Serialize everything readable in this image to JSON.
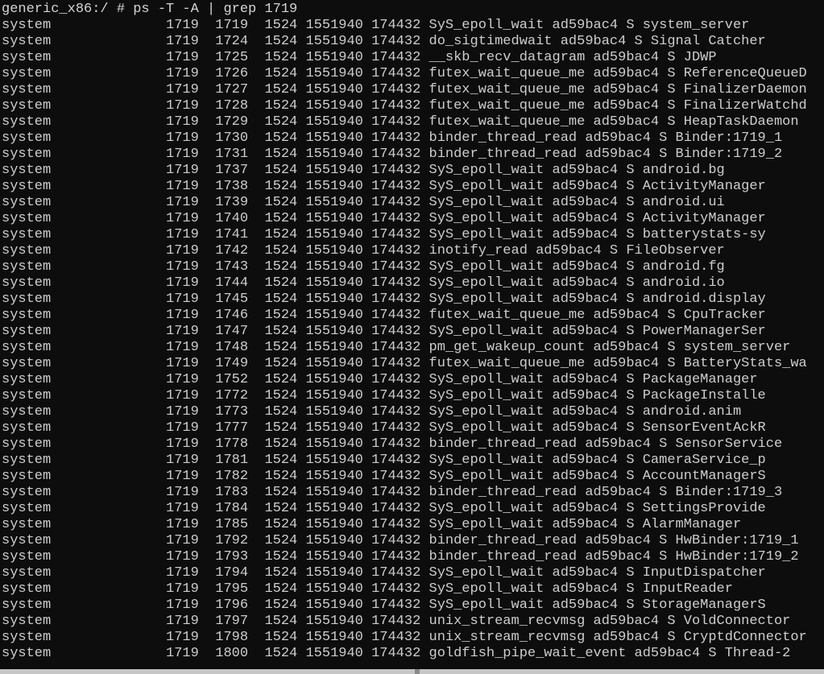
{
  "terminal": {
    "colors": {
      "background": "#0d0d0d",
      "foreground": "#cfcfcf",
      "scrollbar_track": "#c6c6c6",
      "scrollbar_thumb": "#8a8a8a"
    },
    "prompt": {
      "host": "generic_x86",
      "path": "/",
      "symbol": "#",
      "command": "ps -T -A | grep 1719",
      "full_line": "generic_x86:/ # ps -T -A | grep 1719"
    },
    "columns": {
      "user_width": 18,
      "pid_width": 6,
      "tid_width": 6,
      "ppid_width": 6,
      "vsz_width": 8,
      "rss_width": 7
    },
    "rows": [
      {
        "user": "system",
        "pid": "1719",
        "tid": "1719",
        "ppid": "1524",
        "vsz": "1551940",
        "rss": "174432",
        "wchan": "SyS_epoll_wait",
        "addr": "ad59bac4",
        "s": "S",
        "name": "system_server"
      },
      {
        "user": "system",
        "pid": "1719",
        "tid": "1724",
        "ppid": "1524",
        "vsz": "1551940",
        "rss": "174432",
        "wchan": "do_sigtimedwait",
        "addr": "ad59bac4",
        "s": "S",
        "name": "Signal Catcher"
      },
      {
        "user": "system",
        "pid": "1719",
        "tid": "1725",
        "ppid": "1524",
        "vsz": "1551940",
        "rss": "174432",
        "wchan": "__skb_recv_datagram",
        "addr": "ad59bac4",
        "s": "S",
        "name": "JDWP"
      },
      {
        "user": "system",
        "pid": "1719",
        "tid": "1726",
        "ppid": "1524",
        "vsz": "1551940",
        "rss": "174432",
        "wchan": "futex_wait_queue_me",
        "addr": "ad59bac4",
        "s": "S",
        "name": "ReferenceQueueD"
      },
      {
        "user": "system",
        "pid": "1719",
        "tid": "1727",
        "ppid": "1524",
        "vsz": "1551940",
        "rss": "174432",
        "wchan": "futex_wait_queue_me",
        "addr": "ad59bac4",
        "s": "S",
        "name": "FinalizerDaemon"
      },
      {
        "user": "system",
        "pid": "1719",
        "tid": "1728",
        "ppid": "1524",
        "vsz": "1551940",
        "rss": "174432",
        "wchan": "futex_wait_queue_me",
        "addr": "ad59bac4",
        "s": "S",
        "name": "FinalizerWatchd"
      },
      {
        "user": "system",
        "pid": "1719",
        "tid": "1729",
        "ppid": "1524",
        "vsz": "1551940",
        "rss": "174432",
        "wchan": "futex_wait_queue_me",
        "addr": "ad59bac4",
        "s": "S",
        "name": "HeapTaskDaemon"
      },
      {
        "user": "system",
        "pid": "1719",
        "tid": "1730",
        "ppid": "1524",
        "vsz": "1551940",
        "rss": "174432",
        "wchan": "binder_thread_read",
        "addr": "ad59bac4",
        "s": "S",
        "name": "Binder:1719_1"
      },
      {
        "user": "system",
        "pid": "1719",
        "tid": "1731",
        "ppid": "1524",
        "vsz": "1551940",
        "rss": "174432",
        "wchan": "binder_thread_read",
        "addr": "ad59bac4",
        "s": "S",
        "name": "Binder:1719_2"
      },
      {
        "user": "system",
        "pid": "1719",
        "tid": "1737",
        "ppid": "1524",
        "vsz": "1551940",
        "rss": "174432",
        "wchan": "SyS_epoll_wait",
        "addr": "ad59bac4",
        "s": "S",
        "name": "android.bg"
      },
      {
        "user": "system",
        "pid": "1719",
        "tid": "1738",
        "ppid": "1524",
        "vsz": "1551940",
        "rss": "174432",
        "wchan": "SyS_epoll_wait",
        "addr": "ad59bac4",
        "s": "S",
        "name": "ActivityManager"
      },
      {
        "user": "system",
        "pid": "1719",
        "tid": "1739",
        "ppid": "1524",
        "vsz": "1551940",
        "rss": "174432",
        "wchan": "SyS_epoll_wait",
        "addr": "ad59bac4",
        "s": "S",
        "name": "android.ui"
      },
      {
        "user": "system",
        "pid": "1719",
        "tid": "1740",
        "ppid": "1524",
        "vsz": "1551940",
        "rss": "174432",
        "wchan": "SyS_epoll_wait",
        "addr": "ad59bac4",
        "s": "S",
        "name": "ActivityManager"
      },
      {
        "user": "system",
        "pid": "1719",
        "tid": "1741",
        "ppid": "1524",
        "vsz": "1551940",
        "rss": "174432",
        "wchan": "SyS_epoll_wait",
        "addr": "ad59bac4",
        "s": "S",
        "name": "batterystats-sy"
      },
      {
        "user": "system",
        "pid": "1719",
        "tid": "1742",
        "ppid": "1524",
        "vsz": "1551940",
        "rss": "174432",
        "wchan": "inotify_read",
        "addr": "ad59bac4",
        "s": "S",
        "name": "FileObserver"
      },
      {
        "user": "system",
        "pid": "1719",
        "tid": "1743",
        "ppid": "1524",
        "vsz": "1551940",
        "rss": "174432",
        "wchan": "SyS_epoll_wait",
        "addr": "ad59bac4",
        "s": "S",
        "name": "android.fg"
      },
      {
        "user": "system",
        "pid": "1719",
        "tid": "1744",
        "ppid": "1524",
        "vsz": "1551940",
        "rss": "174432",
        "wchan": "SyS_epoll_wait",
        "addr": "ad59bac4",
        "s": "S",
        "name": "android.io"
      },
      {
        "user": "system",
        "pid": "1719",
        "tid": "1745",
        "ppid": "1524",
        "vsz": "1551940",
        "rss": "174432",
        "wchan": "SyS_epoll_wait",
        "addr": "ad59bac4",
        "s": "S",
        "name": "android.display"
      },
      {
        "user": "system",
        "pid": "1719",
        "tid": "1746",
        "ppid": "1524",
        "vsz": "1551940",
        "rss": "174432",
        "wchan": "futex_wait_queue_me",
        "addr": "ad59bac4",
        "s": "S",
        "name": "CpuTracker"
      },
      {
        "user": "system",
        "pid": "1719",
        "tid": "1747",
        "ppid": "1524",
        "vsz": "1551940",
        "rss": "174432",
        "wchan": "SyS_epoll_wait",
        "addr": "ad59bac4",
        "s": "S",
        "name": "PowerManagerSer"
      },
      {
        "user": "system",
        "pid": "1719",
        "tid": "1748",
        "ppid": "1524",
        "vsz": "1551940",
        "rss": "174432",
        "wchan": "pm_get_wakeup_count",
        "addr": "ad59bac4",
        "s": "S",
        "name": "system_server"
      },
      {
        "user": "system",
        "pid": "1719",
        "tid": "1749",
        "ppid": "1524",
        "vsz": "1551940",
        "rss": "174432",
        "wchan": "futex_wait_queue_me",
        "addr": "ad59bac4",
        "s": "S",
        "name": "BatteryStats_wa"
      },
      {
        "user": "system",
        "pid": "1719",
        "tid": "1752",
        "ppid": "1524",
        "vsz": "1551940",
        "rss": "174432",
        "wchan": "SyS_epoll_wait",
        "addr": "ad59bac4",
        "s": "S",
        "name": "PackageManager"
      },
      {
        "user": "system",
        "pid": "1719",
        "tid": "1772",
        "ppid": "1524",
        "vsz": "1551940",
        "rss": "174432",
        "wchan": "SyS_epoll_wait",
        "addr": "ad59bac4",
        "s": "S",
        "name": "PackageInstalle"
      },
      {
        "user": "system",
        "pid": "1719",
        "tid": "1773",
        "ppid": "1524",
        "vsz": "1551940",
        "rss": "174432",
        "wchan": "SyS_epoll_wait",
        "addr": "ad59bac4",
        "s": "S",
        "name": "android.anim"
      },
      {
        "user": "system",
        "pid": "1719",
        "tid": "1777",
        "ppid": "1524",
        "vsz": "1551940",
        "rss": "174432",
        "wchan": "SyS_epoll_wait",
        "addr": "ad59bac4",
        "s": "S",
        "name": "SensorEventAckR"
      },
      {
        "user": "system",
        "pid": "1719",
        "tid": "1778",
        "ppid": "1524",
        "vsz": "1551940",
        "rss": "174432",
        "wchan": "binder_thread_read",
        "addr": "ad59bac4",
        "s": "S",
        "name": "SensorService"
      },
      {
        "user": "system",
        "pid": "1719",
        "tid": "1781",
        "ppid": "1524",
        "vsz": "1551940",
        "rss": "174432",
        "wchan": "SyS_epoll_wait",
        "addr": "ad59bac4",
        "s": "S",
        "name": "CameraService_p"
      },
      {
        "user": "system",
        "pid": "1719",
        "tid": "1782",
        "ppid": "1524",
        "vsz": "1551940",
        "rss": "174432",
        "wchan": "SyS_epoll_wait",
        "addr": "ad59bac4",
        "s": "S",
        "name": "AccountManagerS"
      },
      {
        "user": "system",
        "pid": "1719",
        "tid": "1783",
        "ppid": "1524",
        "vsz": "1551940",
        "rss": "174432",
        "wchan": "binder_thread_read",
        "addr": "ad59bac4",
        "s": "S",
        "name": "Binder:1719_3"
      },
      {
        "user": "system",
        "pid": "1719",
        "tid": "1784",
        "ppid": "1524",
        "vsz": "1551940",
        "rss": "174432",
        "wchan": "SyS_epoll_wait",
        "addr": "ad59bac4",
        "s": "S",
        "name": "SettingsProvide"
      },
      {
        "user": "system",
        "pid": "1719",
        "tid": "1785",
        "ppid": "1524",
        "vsz": "1551940",
        "rss": "174432",
        "wchan": "SyS_epoll_wait",
        "addr": "ad59bac4",
        "s": "S",
        "name": "AlarmManager"
      },
      {
        "user": "system",
        "pid": "1719",
        "tid": "1792",
        "ppid": "1524",
        "vsz": "1551940",
        "rss": "174432",
        "wchan": "binder_thread_read",
        "addr": "ad59bac4",
        "s": "S",
        "name": "HwBinder:1719_1"
      },
      {
        "user": "system",
        "pid": "1719",
        "tid": "1793",
        "ppid": "1524",
        "vsz": "1551940",
        "rss": "174432",
        "wchan": "binder_thread_read",
        "addr": "ad59bac4",
        "s": "S",
        "name": "HwBinder:1719_2"
      },
      {
        "user": "system",
        "pid": "1719",
        "tid": "1794",
        "ppid": "1524",
        "vsz": "1551940",
        "rss": "174432",
        "wchan": "SyS_epoll_wait",
        "addr": "ad59bac4",
        "s": "S",
        "name": "InputDispatcher"
      },
      {
        "user": "system",
        "pid": "1719",
        "tid": "1795",
        "ppid": "1524",
        "vsz": "1551940",
        "rss": "174432",
        "wchan": "SyS_epoll_wait",
        "addr": "ad59bac4",
        "s": "S",
        "name": "InputReader"
      },
      {
        "user": "system",
        "pid": "1719",
        "tid": "1796",
        "ppid": "1524",
        "vsz": "1551940",
        "rss": "174432",
        "wchan": "SyS_epoll_wait",
        "addr": "ad59bac4",
        "s": "S",
        "name": "StorageManagerS"
      },
      {
        "user": "system",
        "pid": "1719",
        "tid": "1797",
        "ppid": "1524",
        "vsz": "1551940",
        "rss": "174432",
        "wchan": "unix_stream_recvmsg",
        "addr": "ad59bac4",
        "s": "S",
        "name": "VoldConnector"
      },
      {
        "user": "system",
        "pid": "1719",
        "tid": "1798",
        "ppid": "1524",
        "vsz": "1551940",
        "rss": "174432",
        "wchan": "unix_stream_recvmsg",
        "addr": "ad59bac4",
        "s": "S",
        "name": "CryptdConnector"
      },
      {
        "user": "system",
        "pid": "1719",
        "tid": "1800",
        "ppid": "1524",
        "vsz": "1551940",
        "rss": "174432",
        "wchan": "goldfish_pipe_wait_event",
        "addr": "ad59bac4",
        "s": "S",
        "name": "Thread-2"
      }
    ]
  }
}
